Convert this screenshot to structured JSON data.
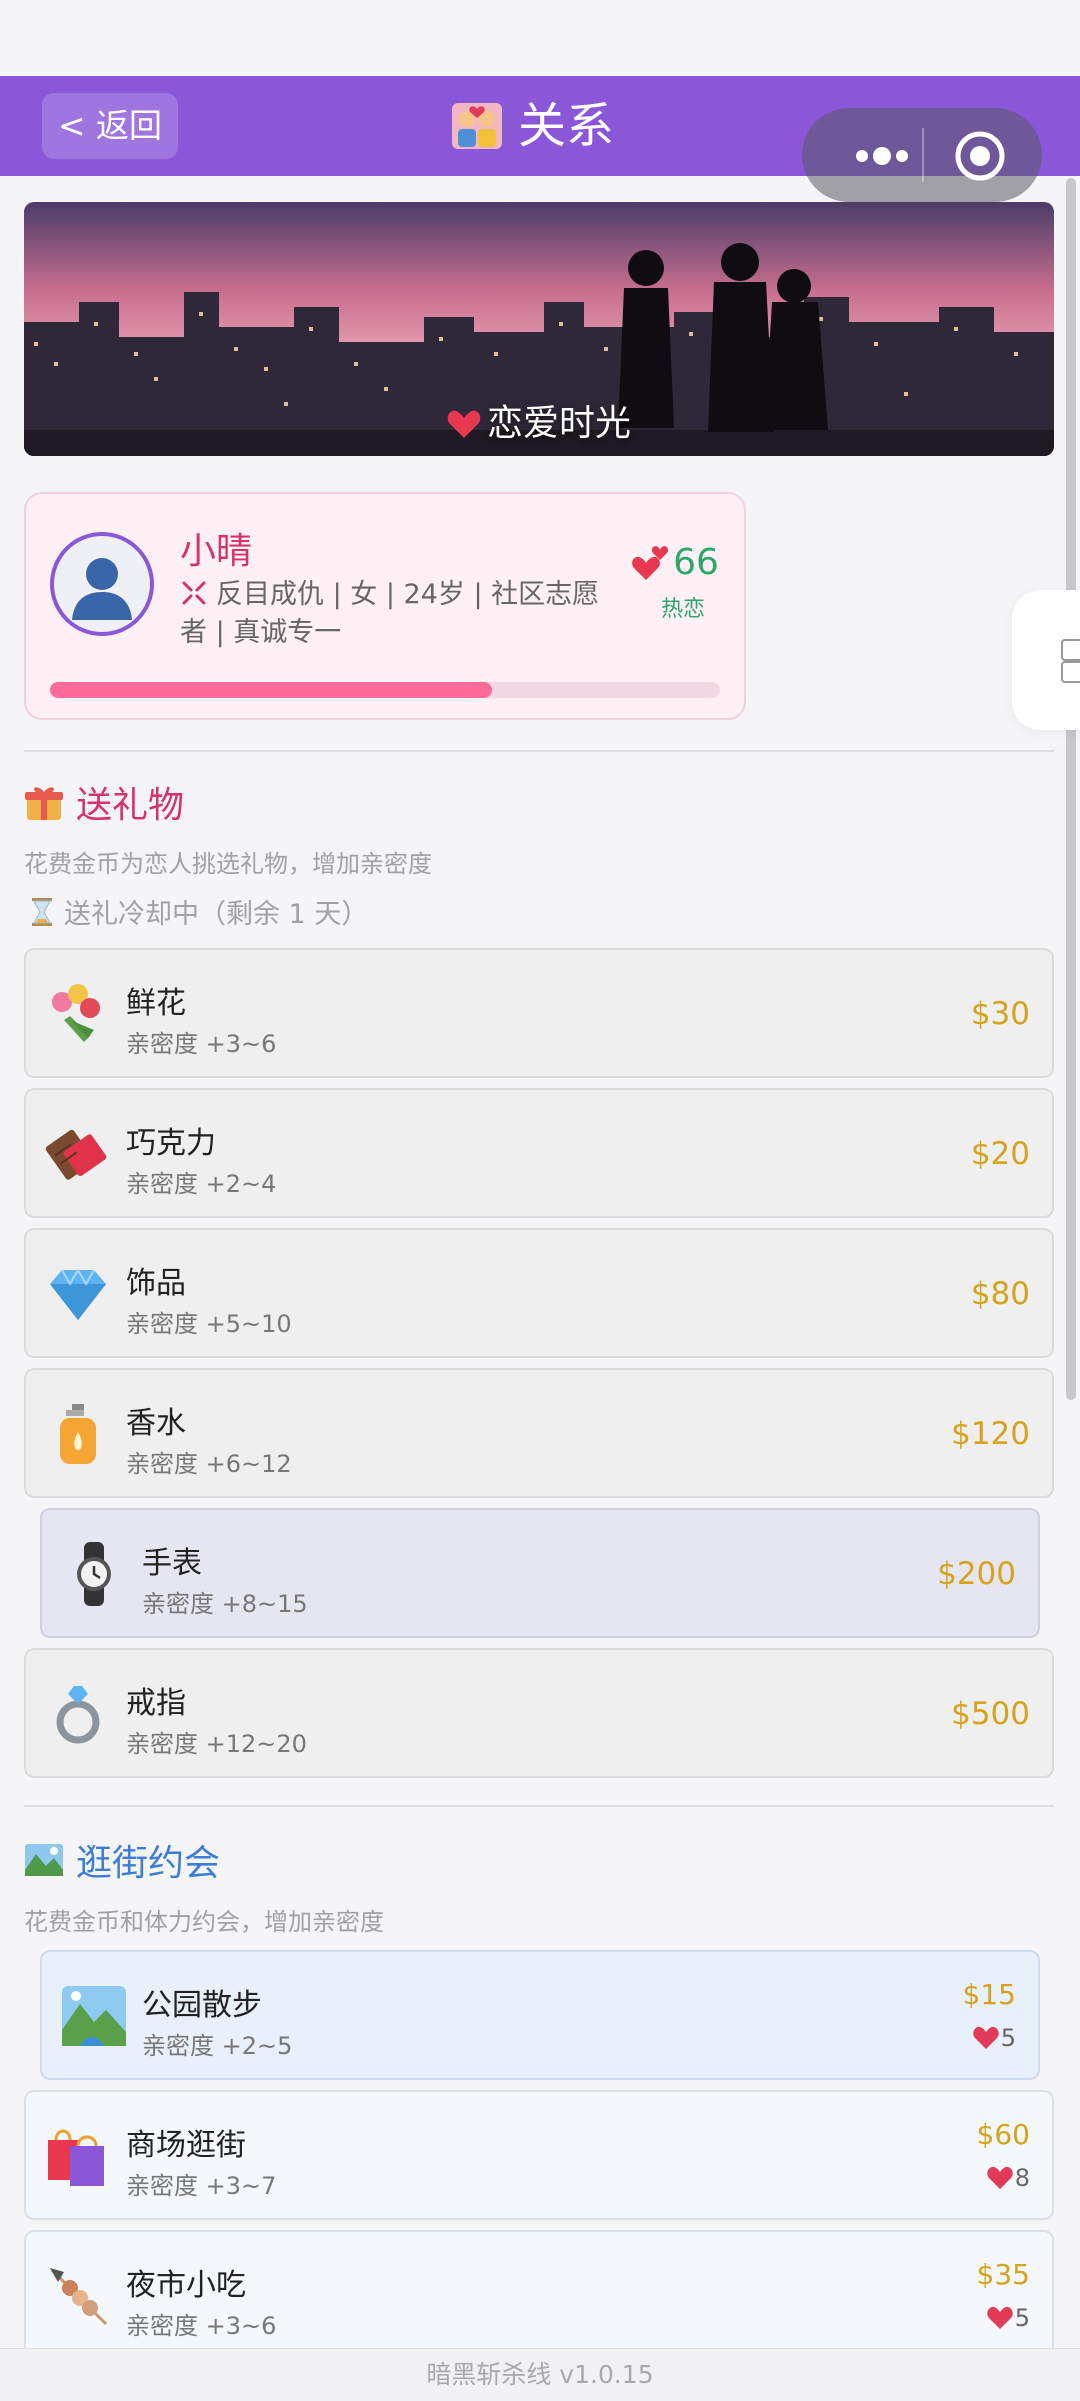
{
  "header": {
    "back_label": "< 返回",
    "title": "关系"
  },
  "hero": {
    "caption": "恋爱时光"
  },
  "partner": {
    "name": "小晴",
    "info": "反目成仇 | 女 | 24岁 | 社区志愿者 | 真诚专一",
    "score": "66",
    "stage": "热恋",
    "progress_fraction": 0.66
  },
  "gifts": {
    "title": "送礼物",
    "desc": "花费金币为恋人挑选礼物，增加亲密度",
    "cooldown": "送礼冷却中（剩余 1 天）",
    "items": [
      {
        "name": "鲜花",
        "effect": "亲密度 +3~6",
        "price": "$30",
        "icon": "bouquet-icon"
      },
      {
        "name": "巧克力",
        "effect": "亲密度 +2~4",
        "price": "$20",
        "icon": "chocolate-icon"
      },
      {
        "name": "饰品",
        "effect": "亲密度 +5~10",
        "price": "$80",
        "icon": "diamond-icon"
      },
      {
        "name": "香水",
        "effect": "亲密度 +6~12",
        "price": "$120",
        "icon": "perfume-icon"
      },
      {
        "name": "手表",
        "effect": "亲密度 +8~15",
        "price": "$200",
        "icon": "watch-icon"
      },
      {
        "name": "戒指",
        "effect": "亲密度 +12~20",
        "price": "$500",
        "icon": "ring-icon"
      }
    ]
  },
  "dates": {
    "title": "逛街约会",
    "desc": "花费金币和体力约会，增加亲密度",
    "items": [
      {
        "name": "公园散步",
        "effect": "亲密度 +2~5",
        "price": "$15",
        "energy": "5",
        "icon": "park-icon"
      },
      {
        "name": "商场逛街",
        "effect": "亲密度 +3~7",
        "price": "$60",
        "energy": "8",
        "icon": "shopping-bags-icon"
      },
      {
        "name": "夜市小吃",
        "effect": "亲密度 +3~6",
        "price": "$35",
        "energy": "5",
        "icon": "skewer-icon"
      }
    ]
  },
  "footer": {
    "version": "暗黑斩杀线 v1.0.15"
  },
  "colors": {
    "header_bg": "#8a57d9",
    "accent_pink": "#d6336c",
    "score_green": "#2ca66a",
    "price_gold": "#d6a31e",
    "progress": "#ff6b98"
  }
}
